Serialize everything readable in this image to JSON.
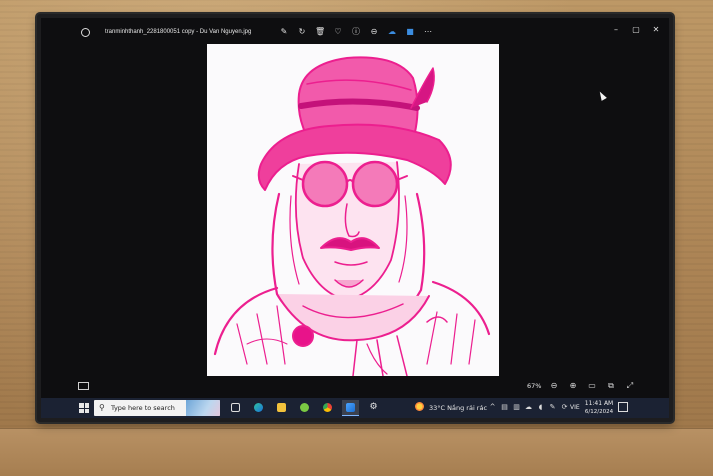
{
  "window": {
    "title": "tranminhthanh_2281800051 copy - Du Van Nguyen.jpg",
    "toolbar_icons": [
      "edit-icon",
      "rotate-icon",
      "delete-icon",
      "favorite-icon",
      "info-icon",
      "crop-icon",
      "cloud-icon",
      "clipchamp-icon",
      "more-icon"
    ],
    "controls": [
      "minimize-icon",
      "maximize-icon",
      "close-icon"
    ]
  },
  "image": {
    "subject": "pink sketch portrait",
    "accent": "#ec1f8f"
  },
  "zoom": {
    "level": "67%"
  },
  "taskbar": {
    "search_placeholder": "Type here to search",
    "apps": [
      "task-view-icon",
      "edge-icon",
      "file-explorer-icon",
      "app-icon",
      "chrome-icon",
      "photos-icon",
      "settings-icon"
    ],
    "weather": "33°C  Nắng rải rác",
    "language": "VIE",
    "time": "11:41 AM",
    "date": "6/12/2024"
  },
  "colors": {
    "taskbar": "#1b2233",
    "screen": "#0e0e10",
    "wall": "#b08a5c"
  }
}
